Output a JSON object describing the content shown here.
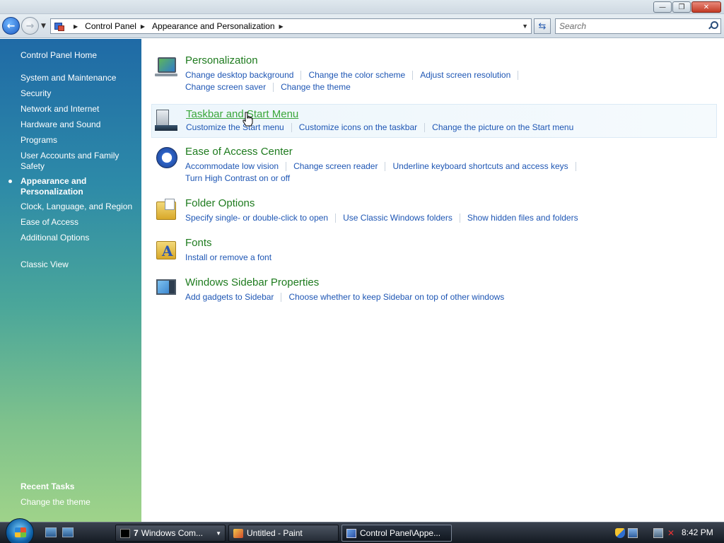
{
  "window": {
    "buttons": [
      "minimize",
      "maximize",
      "close"
    ]
  },
  "navigation": {
    "breadcrumb": [
      "Control Panel",
      "Appearance and Personalization"
    ],
    "search_placeholder": "Search"
  },
  "sidebar": {
    "home": "Control Panel Home",
    "items": [
      "System and Maintenance",
      "Security",
      "Network and Internet",
      "Hardware and Sound",
      "Programs",
      "User Accounts and Family Safety",
      "Appearance and Personalization",
      "Clock, Language, and Region",
      "Ease of Access",
      "Additional Options"
    ],
    "selected": "Appearance and Personalization",
    "classic_view": "Classic View",
    "recent_tasks_heading": "Recent Tasks",
    "recent_tasks": [
      "Change the theme"
    ]
  },
  "categories": [
    {
      "title": "Personalization",
      "icon": "monitor-icon",
      "tasks": [
        [
          "Change desktop background",
          "Change the color scheme",
          "Adjust screen resolution"
        ],
        [
          "Change screen saver",
          "Change the theme"
        ]
      ]
    },
    {
      "title": "Taskbar and Start Menu",
      "icon": "taskbar-icon",
      "tasks": [
        [
          "Customize the Start menu",
          "Customize icons on the taskbar",
          "Change the picture on the Start menu"
        ]
      ]
    },
    {
      "title": "Ease of Access Center",
      "icon": "ease-of-access-icon",
      "tasks": [
        [
          "Accommodate low vision",
          "Change screen reader",
          "Underline keyboard shortcuts and access keys"
        ],
        [
          "Turn High Contrast on or off"
        ]
      ]
    },
    {
      "title": "Folder Options",
      "icon": "folder-icon",
      "tasks": [
        [
          "Specify single- or double-click to open",
          "Use Classic Windows folders",
          "Show hidden files and folders"
        ]
      ]
    },
    {
      "title": "Fonts",
      "icon": "fonts-icon",
      "tasks": [
        [
          "Install or remove a font"
        ]
      ]
    },
    {
      "title": "Windows Sidebar Properties",
      "icon": "sidebar-icon",
      "tasks": [
        [
          "Add gadgets to Sidebar",
          "Choose whether to keep Sidebar on top of other windows"
        ]
      ]
    }
  ],
  "taskbar": {
    "buttons": [
      {
        "count": "7",
        "label": "Windows Com..."
      },
      {
        "label": "Untitled - Paint"
      },
      {
        "label": "Control Panel\\Appe..."
      }
    ],
    "clock": "8:42 PM"
  },
  "colors": {
    "category_title": "#1e7b1e",
    "task_link": "#1e56b4",
    "sidebar_gradient_top": "#1f6aa6",
    "sidebar_gradient_bottom": "#9fd38a"
  }
}
